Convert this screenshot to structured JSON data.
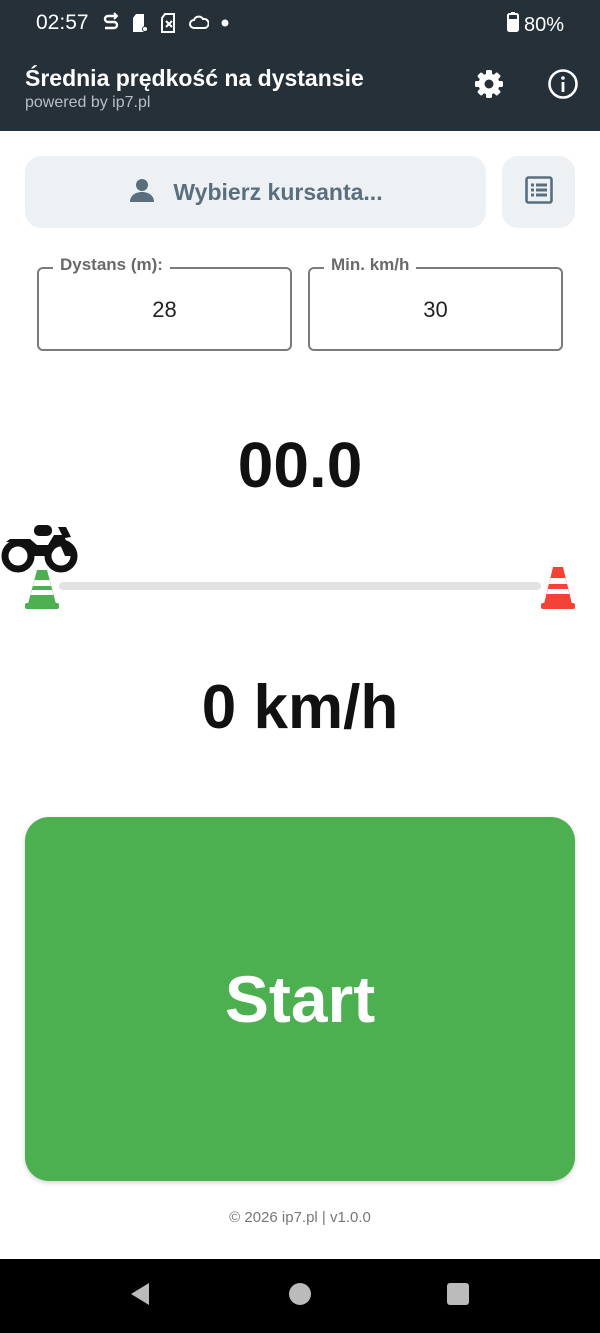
{
  "status_bar": {
    "time": "02:57",
    "battery": "80%",
    "icons": [
      "sync-icon",
      "battery-alert-icon",
      "sim-icon",
      "cloud-icon",
      "dot-icon"
    ]
  },
  "app_bar": {
    "title": "Średnia prędkość na dystansie",
    "subtitle": "powered by ip7.pl",
    "actions": [
      "settings-icon",
      "info-icon"
    ]
  },
  "student": {
    "label": "Wybierz kursanta..."
  },
  "fields": {
    "distance_label": "Dystans (m):",
    "distance_value": "28",
    "min_speed_label": "Min. km/h",
    "min_speed_value": "30"
  },
  "display": {
    "timer": "00.0",
    "speed": "0 km/h"
  },
  "track": {
    "progress": 0
  },
  "start_button": {
    "label": "Start"
  },
  "footer": {
    "text": "© 2026 ip7.pl | v1.0.0"
  },
  "colors": {
    "app_bar": "#263039",
    "start_button": "#4caf50",
    "start_cone": "#4caf50",
    "end_cone": "#f44336"
  }
}
